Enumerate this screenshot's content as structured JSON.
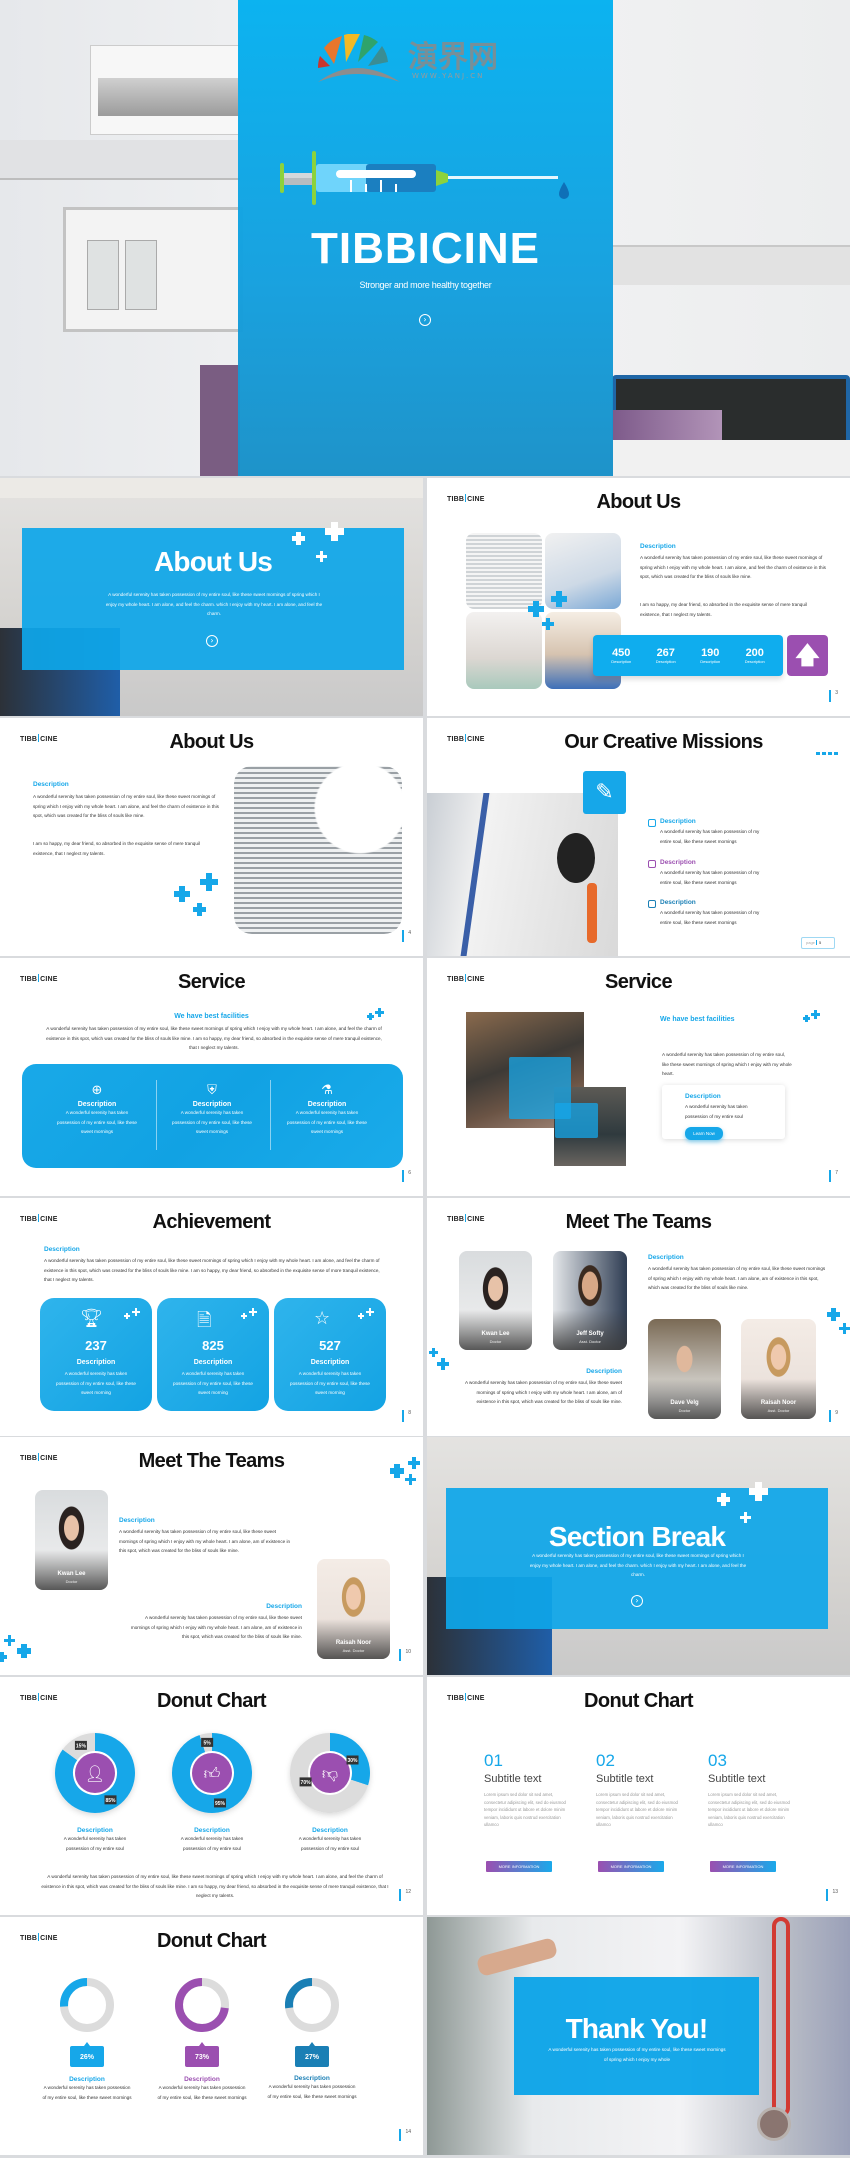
{
  "brand": {
    "left": "TIBB",
    "right": "CINE"
  },
  "colors": {
    "primary": "#16a7e9",
    "purple": "#9b4fb0",
    "dark_blue": "#1a7fb5",
    "grey": "#dcdcdc"
  },
  "title_slide": {
    "logo_cn": "演界网",
    "logo_url": "WWW.YANJ.CN",
    "title": "TIBBICINE",
    "tagline": "Stronger and more healthy together",
    "arrow_icon": "chevron-right-circle-icon"
  },
  "about_hero": {
    "title": "About Us",
    "body": "A wonderful serenity has taken possession of my entire soul, like these sweet mornings of spring which I enjoy my whole heart. I am alone, and feel the charm. which I enjoy with my heart. I am alone, and feel the charm."
  },
  "about_stats": {
    "title": "About Us",
    "description": "Description",
    "p1": "A wonderful serenity has taken possession of my entire soul, like these sweet mornings of spring which I enjoy with my whole heart. I am alone, and feel the charm of existence in this spot, which was created for the bliss of souls like mine.",
    "p2": "I am so happy, my dear friend, so absorbed in the exquisite sense of mere tranquil existence, that I neglect my talents.",
    "stats": [
      {
        "value": "450",
        "label": "Description"
      },
      {
        "value": "267",
        "label": "Description"
      },
      {
        "value": "190",
        "label": "Description"
      },
      {
        "value": "200",
        "label": "Description"
      }
    ],
    "page": "3"
  },
  "about2": {
    "title": "About Us",
    "description": "Description",
    "p1": "A wonderful serenity has taken possession of my entire soul, like these sweet mornings of spring which I enjoy with my whole heart. I am alone, and feel the charm of existence in this spot, which was created for the bliss of souls like mine.",
    "p2": "I am so happy, my dear friend, so absorbed in the exquisite sense of mere tranquil existence, that I neglect my talents.",
    "page": "4"
  },
  "missions": {
    "title": "Our Creative Missions",
    "items": [
      {
        "label": "Description",
        "text": "A wonderful serenity has taken possession of my entire soul, like these sweet mornings"
      },
      {
        "label": "Description",
        "text": "A wonderful serenity has taken possession of my entire soul, like these sweet mornings"
      },
      {
        "label": "Description",
        "text": "A wonderful serenity has taken possession of my entire soul, like these sweet mornings"
      }
    ],
    "page_label": "page",
    "page": "5"
  },
  "service1": {
    "title": "Service",
    "subtitle": "We have best facilities",
    "body": "A wonderful serenity has taken possession of my entire soul, like these sweet mornings of spring which I enjoy with my whole heart. I am alone, and feel the charm of existence in this spot, which was created for the bliss of souls like mine. I am so happy, my dear friend, so absorbed in the exquisite sense of mere tranquil existence, that I neglect my talents.",
    "features": [
      {
        "icon": "lifebuoy-icon",
        "label": "Description",
        "text": "A wonderful serenity has taken possession of my entire soul, like these sweet mornings"
      },
      {
        "icon": "shield-plus-icon",
        "label": "Description",
        "text": "A wonderful serenity has taken possession of my entire soul, like these sweet mornings"
      },
      {
        "icon": "flask-icon",
        "label": "Description",
        "text": "A wonderful serenity has taken possession of my entire soul, like these sweet mornings"
      }
    ],
    "page": "6"
  },
  "service2": {
    "title": "Service",
    "subtitle": "We have best facilities",
    "body": "A wonderful serenity has taken possession of my entire soul, like these sweet mornings of spring which I enjoy with my whole heart.",
    "card": {
      "label": "Description",
      "text": "A wonderful serenity has taken possession of my entire soul",
      "button": "Learn Now"
    },
    "page": "7"
  },
  "achievement": {
    "title": "Achievement",
    "description": "Description",
    "body": "A wonderful serenity has taken possession of my entire soul, like these sweet mornings of spring which I enjoy with my whole heart. I am alone, and feel the charm of existence in this spot, which was created for the bliss of souls like mine. I am so happy, my dear friend, so absorbed in the exquisite sense of more tranquil existence, that I neglect my talents.",
    "cards": [
      {
        "icon": "trophy-icon",
        "value": "237",
        "label": "Description",
        "text": "A wonderful serenity has taken possession of my entire soul, like these sweet morning"
      },
      {
        "icon": "document-icon",
        "value": "825",
        "label": "Description",
        "text": "A wonderful serenity has taken possession of my entire soul, like these sweet morning"
      },
      {
        "icon": "star-icon",
        "value": "527",
        "label": "Description",
        "text": "A wonderful serenity has taken possession of my entire soul, like these sweet morning"
      }
    ],
    "page": "8"
  },
  "teams1": {
    "title": "Meet The Teams",
    "members": [
      {
        "name": "Kwan Lee",
        "role": "Doctor"
      },
      {
        "name": "Jeff Softy",
        "role": "Asst. Doctor"
      },
      {
        "name": "Dave Velg",
        "role": "Doctor"
      },
      {
        "name": "Raisah Noor",
        "role": "Asst. Doctor"
      }
    ],
    "description": "Description",
    "text": "A wonderful serenity has taken possession of my entire soul, like these sweet mornings of spring which I enjoy with my whole heart. I am alone, am of existence in this spot, which was created for the bliss of souls like mine.",
    "description2": "Description",
    "text2": "A wonderful serenity has taken possession of my entire soul, like these sweet mornings of spring which I enjoy with my whole heart. I am alone, am of existence in this spot, which was created for the bliss of souls like mine.",
    "page": "9"
  },
  "teams2": {
    "title": "Meet The Teams",
    "members": [
      {
        "name": "Kwan Lee",
        "role": "Doctor"
      },
      {
        "name": "Raisah Noor",
        "role": "Asst. Doctor"
      }
    ],
    "description": "Description",
    "text": "A wonderful serenity has taken possession of my entire soul, like these sweet mornings of spring which I enjoy with my whole heart. I am alone, am of existence in this spot, which was created for the bliss of souls like mine.",
    "description2": "Description",
    "text2": "A wonderful serenity has taken possession of my entire soul, like these sweet mornings of spring which I enjoy with my whole heart. I am alone, am of existence in this spot, which was created for the bliss of souls like mine.",
    "page": "10"
  },
  "section_break": {
    "title": "Section Break",
    "body": "A wonderful serenity has taken possession of my entire soul, like these sweet mornings of spring which I enjoy my whole heart. I am alone, and feel the charm. which I enjoy with my heart. I am alone, and feel the charm."
  },
  "donut1": {
    "title": "Donut Chart",
    "items": [
      {
        "label": "Description",
        "text": "A wonderful serenity has taken possession of my entire soul",
        "icon": "user-icon"
      },
      {
        "label": "Description",
        "text": "A wonderful serenity has taken possession of my entire soul",
        "icon": "thumbs-up-icon"
      },
      {
        "label": "Description",
        "text": "A wonderful serenity has taken possession of my entire soul",
        "icon": "thumbs-down-icon"
      }
    ],
    "body": "A wonderful serenity has taken possession of my entire soul, like these sweet mornings of spring which I enjoy with my whole heart. I am alone, and feel the charm of existence in this spot, which was created for the bliss of souls like mine. I am so happy, my dear friend, so absorbed in the exquisite sense of mere tranquil existence, that I neglect my talents.",
    "page": "12"
  },
  "donut2": {
    "title": "Donut Chart",
    "items": [
      {
        "number": "01",
        "subtitle": "Subtitle text",
        "text": "Lorem ipsum sed dolor sit sed amet, consectetur adipiscing elit, sed do eiusmod tempor incididunt ut labore et dolore minim veniam, laboris quis nostrud exercitation ullamco",
        "button": "MORE INFORMATION"
      },
      {
        "number": "02",
        "subtitle": "Subtitle text",
        "text": "Lorem ipsum sed dolor sit sed amet, consectetur adipiscing elit, sed do eiusmod tempor incididunt ut labore et dolore minim veniam, laboris quis nostrud exercitation ullamco",
        "button": "MORE INFORMATION"
      },
      {
        "number": "03",
        "subtitle": "Subtitle text",
        "text": "Lorem ipsum sed dolor sit sed amet, consectetur adipiscing elit, sed do eiusmod tempor incididunt ut labore et dolore minim veniam, laboris quis nostrud exercitation ullamco",
        "button": "MORE INFORMATION"
      }
    ],
    "page": "13"
  },
  "donut3": {
    "title": "Donut Chart",
    "items": [
      {
        "label": "Description",
        "text": "A wonderful serenity has taken possession of my entire soul, like these sweet mornings"
      },
      {
        "label": "Description",
        "text": "A wonderful serenity has taken possession of my entire soul, like these sweet mornings"
      },
      {
        "label": "Description",
        "text": "A wonderful serenity has taken possession of my entire soul, like these sweet mornings"
      }
    ],
    "page": "14"
  },
  "thanks": {
    "title": "Thank You!",
    "body": "A wonderful serenity has taken possession of my entire soul, like these sweet mornings of spring which I enjoy my whole"
  },
  "chart_data": [
    {
      "type": "pie",
      "variant": "donut",
      "slide": "donut1",
      "series": [
        {
          "values": [
            85,
            15
          ],
          "labels": [
            "85%",
            "15%"
          ],
          "colors": [
            "#16a7e9",
            "#dcdcdc"
          ]
        },
        {
          "values": [
            95,
            5
          ],
          "labels": [
            "95%",
            "5%"
          ],
          "colors": [
            "#16a7e9",
            "#dcdcdc"
          ]
        },
        {
          "values": [
            30,
            70
          ],
          "labels": [
            "30%",
            "70%"
          ],
          "colors": [
            "#16a7e9",
            "#dcdcdc"
          ]
        }
      ]
    },
    {
      "type": "pie",
      "variant": "ring",
      "slide": "donut3",
      "series": [
        {
          "value": 26,
          "label": "26%",
          "color": "#16a7e9"
        },
        {
          "value": 73,
          "label": "73%",
          "color": "#9b4fb0"
        },
        {
          "value": 27,
          "label": "27%",
          "color": "#1a7fb5"
        }
      ]
    }
  ]
}
